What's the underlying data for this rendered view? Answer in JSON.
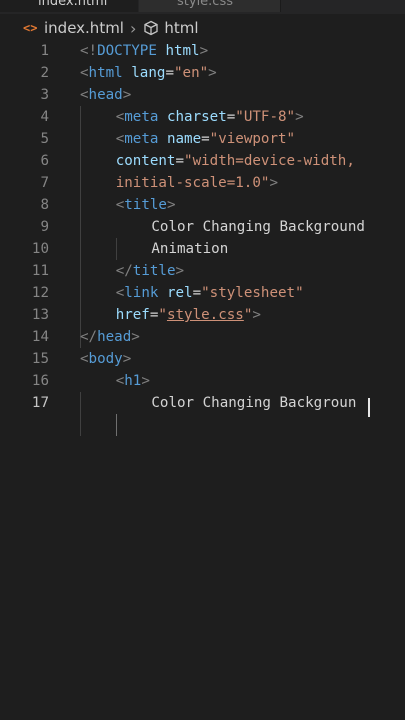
{
  "tabs": [
    {
      "label": "index.html",
      "active": true
    },
    {
      "label": "style.css",
      "active": false
    }
  ],
  "breadcrumb": {
    "file_icon": "html-file-icon",
    "file": "index.html",
    "separator": "›",
    "element_icon": "element-cube-icon",
    "element": "html"
  },
  "colors": {
    "background": "#1e1e1e",
    "tag": "#569cd6",
    "attribute": "#9cdcfe",
    "string": "#ce9178",
    "punctuation": "#808080",
    "text": "#d4d4d4",
    "line_number": "#858585"
  },
  "editor": {
    "current_line": 17,
    "lines": [
      {
        "num": "1",
        "indent": 0,
        "tokens": [
          {
            "t": "<!",
            "c": "punct"
          },
          {
            "t": "DOCTYPE",
            "c": "tag"
          },
          {
            "t": " ",
            "c": "text"
          },
          {
            "t": "html",
            "c": "attr"
          },
          {
            "t": ">",
            "c": "punct"
          }
        ]
      },
      {
        "num": "2",
        "indent": 0,
        "tokens": [
          {
            "t": "<",
            "c": "punct"
          },
          {
            "t": "html",
            "c": "tag"
          },
          {
            "t": " ",
            "c": "text"
          },
          {
            "t": "lang",
            "c": "attr"
          },
          {
            "t": "=",
            "c": "text"
          },
          {
            "t": "\"en\"",
            "c": "str"
          },
          {
            "t": ">",
            "c": "punct"
          }
        ]
      },
      {
        "num": "3",
        "indent": 0,
        "tokens": [
          {
            "t": "<",
            "c": "punct"
          },
          {
            "t": "head",
            "c": "tag"
          },
          {
            "t": ">",
            "c": "punct"
          }
        ]
      },
      {
        "num": "4",
        "indent": 1,
        "tokens": [
          {
            "t": "<",
            "c": "punct"
          },
          {
            "t": "meta",
            "c": "tag"
          },
          {
            "t": " ",
            "c": "text"
          },
          {
            "t": "charset",
            "c": "attr"
          },
          {
            "t": "=",
            "c": "text"
          },
          {
            "t": "\"UTF-8\"",
            "c": "str"
          },
          {
            "t": ">",
            "c": "punct"
          }
        ]
      },
      {
        "num": "5",
        "indent": 1,
        "tokens": [
          {
            "t": "<",
            "c": "punct"
          },
          {
            "t": "meta",
            "c": "tag"
          },
          {
            "t": " ",
            "c": "text"
          },
          {
            "t": "name",
            "c": "attr"
          },
          {
            "t": "=",
            "c": "text"
          },
          {
            "t": "\"viewport\"",
            "c": "str"
          }
        ]
      },
      {
        "num": "6",
        "indent": 1,
        "tokens": [
          {
            "t": "content",
            "c": "attr"
          },
          {
            "t": "=",
            "c": "text"
          },
          {
            "t": "\"width=device-width,",
            "c": "str"
          }
        ]
      },
      {
        "num": "7",
        "indent": 1,
        "tokens": [
          {
            "t": "initial-scale=1.0\"",
            "c": "str"
          },
          {
            "t": ">",
            "c": "punct"
          }
        ]
      },
      {
        "num": "8",
        "indent": 1,
        "tokens": [
          {
            "t": "<",
            "c": "punct"
          },
          {
            "t": "title",
            "c": "tag"
          },
          {
            "t": ">",
            "c": "punct"
          }
        ]
      },
      {
        "num": "9",
        "indent": 2,
        "tokens": [
          {
            "t": "Color Changing Background",
            "c": "text"
          }
        ]
      },
      {
        "num": "10",
        "indent": 2,
        "tokens": [
          {
            "t": "Animation",
            "c": "text"
          }
        ]
      },
      {
        "num": "11",
        "indent": 1,
        "tokens": [
          {
            "t": "</",
            "c": "punct"
          },
          {
            "t": "title",
            "c": "tag"
          },
          {
            "t": ">",
            "c": "punct"
          }
        ]
      },
      {
        "num": "12",
        "indent": 1,
        "tokens": [
          {
            "t": "<",
            "c": "punct"
          },
          {
            "t": "link",
            "c": "tag"
          },
          {
            "t": " ",
            "c": "text"
          },
          {
            "t": "rel",
            "c": "attr"
          },
          {
            "t": "=",
            "c": "text"
          },
          {
            "t": "\"stylesheet\"",
            "c": "str"
          }
        ]
      },
      {
        "num": "13",
        "indent": 1,
        "tokens": [
          {
            "t": "href",
            "c": "attr"
          },
          {
            "t": "=",
            "c": "text"
          },
          {
            "t": "\"",
            "c": "str"
          },
          {
            "t": "style.css",
            "c": "str",
            "link": true
          },
          {
            "t": "\"",
            "c": "str"
          },
          {
            "t": ">",
            "c": "punct"
          }
        ]
      },
      {
        "num": "14",
        "indent": 0,
        "tokens": [
          {
            "t": "</",
            "c": "punct"
          },
          {
            "t": "head",
            "c": "tag"
          },
          {
            "t": ">",
            "c": "punct"
          }
        ]
      },
      {
        "num": "15",
        "indent": 0,
        "tokens": [
          {
            "t": "<",
            "c": "punct"
          },
          {
            "t": "body",
            "c": "tag"
          },
          {
            "t": ">",
            "c": "punct"
          }
        ]
      },
      {
        "num": "16",
        "indent": 1,
        "tokens": [
          {
            "t": "<",
            "c": "punct"
          },
          {
            "t": "h1",
            "c": "tag"
          },
          {
            "t": ">",
            "c": "punct"
          }
        ]
      },
      {
        "num": "17",
        "indent": 2,
        "tokens": [
          {
            "t": "Color Changing Backgroun",
            "c": "text"
          }
        ]
      }
    ]
  }
}
